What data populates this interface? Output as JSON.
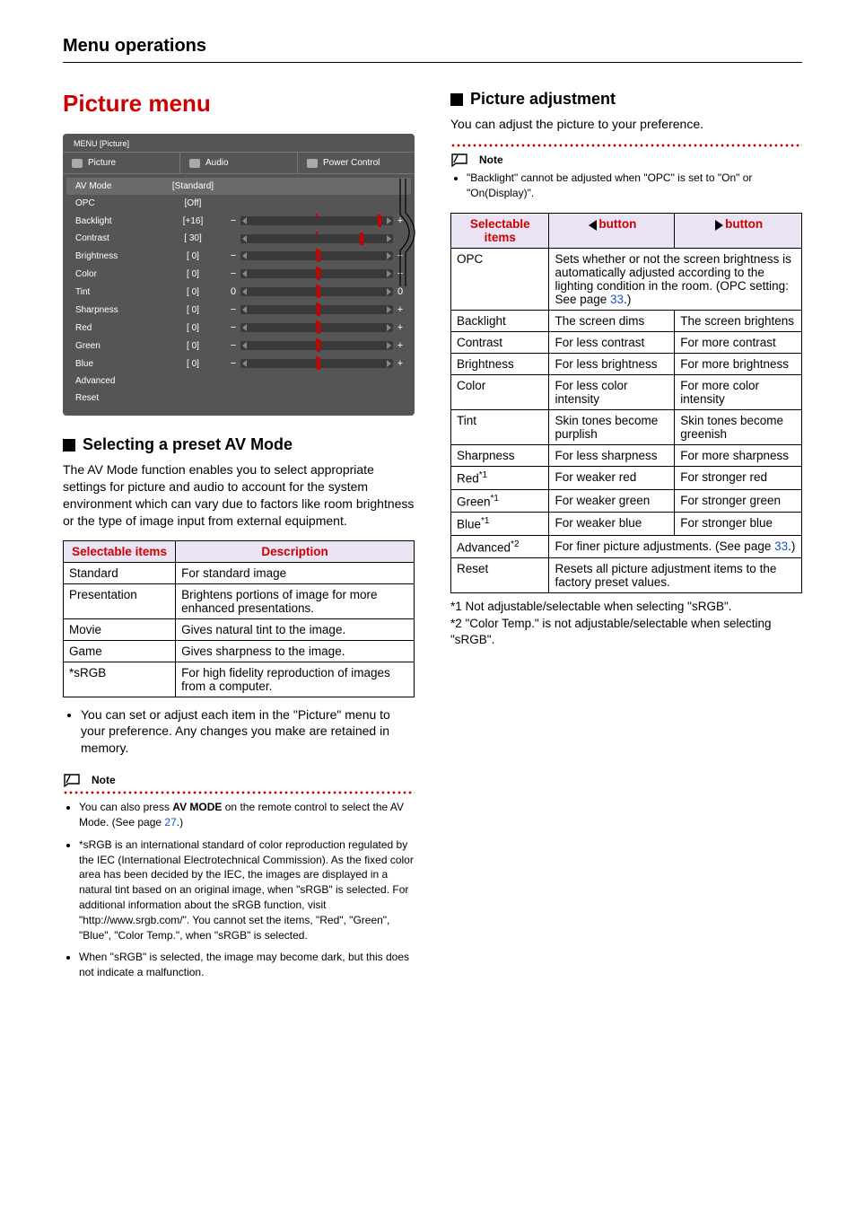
{
  "header": {
    "title": "Menu operations"
  },
  "left": {
    "h1": "Picture menu",
    "panel": {
      "title": "MENU [Picture]",
      "tabs": [
        "Picture",
        "Audio",
        "Power Control"
      ],
      "rows": [
        {
          "label": "AV Mode",
          "value": "[Standard]",
          "slider": false
        },
        {
          "label": "OPC",
          "value": "[Off]",
          "slider": false
        },
        {
          "label": "Backlight",
          "value": "[+16]",
          "slider": true,
          "thumb_pct": 90,
          "left_zero": false
        },
        {
          "label": "Contrast",
          "value": "[  30]",
          "slider": true,
          "thumb_pct": 78,
          "left_zero": false,
          "no_signs": true
        },
        {
          "label": "Brightness",
          "value": "[    0]",
          "slider": true,
          "thumb_pct": 50,
          "left_zero": false
        },
        {
          "label": "Color",
          "value": "[    0]",
          "slider": true,
          "thumb_pct": 50,
          "left_zero": false
        },
        {
          "label": "Tint",
          "value": "[    0]",
          "slider": true,
          "thumb_pct": 50,
          "left_zero": true
        },
        {
          "label": "Sharpness",
          "value": "[    0]",
          "slider": true,
          "thumb_pct": 50,
          "left_zero": false
        },
        {
          "label": "Red",
          "value": "[    0]",
          "slider": true,
          "thumb_pct": 50,
          "left_zero": false
        },
        {
          "label": "Green",
          "value": "[    0]",
          "slider": true,
          "thumb_pct": 50,
          "left_zero": false
        },
        {
          "label": "Blue",
          "value": "[    0]",
          "slider": true,
          "thumb_pct": 50,
          "left_zero": false
        },
        {
          "label": "Advanced",
          "value": "",
          "slider": false
        },
        {
          "label": "Reset",
          "value": "",
          "slider": false
        }
      ]
    },
    "avmode": {
      "heading": "Selecting a preset AV Mode",
      "desc": "The AV Mode function enables you to select appropriate settings for picture and audio to account for the system environment which can vary due to factors like room brightness or the type of image input from external equipment.",
      "table_head": [
        "Selectable items",
        "Description"
      ],
      "rows": [
        {
          "item": "Standard",
          "desc": "For standard image"
        },
        {
          "item": "Presentation",
          "desc": "Brightens portions of image for more enhanced presentations."
        },
        {
          "item": "Movie",
          "desc": "Gives natural tint to the image."
        },
        {
          "item": "Game",
          "desc": "Gives sharpness to the image."
        },
        {
          "item": "*sRGB",
          "desc": "For high fidelity reproduction of images from a computer."
        }
      ],
      "footer_bullet": "You can set or adjust each item in the \"Picture\" menu to your preference. Any changes you make are retained in memory."
    },
    "note": {
      "label": "Note",
      "items": [
        {
          "pre": "You can also press ",
          "bold": "AV MODE",
          "post": " on the remote control to select the AV Mode. (See page ",
          "link": "27",
          "tail": ".)"
        },
        {
          "text": "*sRGB is an international standard of color reproduction regulated by the IEC (International Electrotechnical Commission). As the fixed color area has been decided by the IEC, the images are displayed in a natural tint based on an original image, when \"sRGB\" is selected. For additional information about the sRGB function, visit \"http://www.srgb.com/\". You cannot set the items, \"Red\", \"Green\", \"Blue\", \"Color Temp.\", when \"sRGB\" is selected."
        },
        {
          "text": "When \"sRGB\" is selected, the image may become dark, but this does not indicate a malfunction."
        }
      ]
    }
  },
  "right": {
    "heading": "Picture adjustment",
    "desc": "You can adjust the picture to your preference.",
    "note": {
      "label": "Note",
      "text": "\"Backlight\" cannot be adjusted when \"OPC\" is set to \"On\" or \"On(Display)\"."
    },
    "table_head": {
      "items": "Selectable items",
      "left": "button",
      "right": "button"
    },
    "opc_cell": {
      "pre": "Sets whether or not the screen brightness is automatically adjusted according to the lighting condition in the room. (OPC setting: See page ",
      "link": "33",
      "tail": ".)"
    },
    "rows": [
      {
        "item": "OPC",
        "span": true
      },
      {
        "item": "Backlight",
        "l": "The screen dims",
        "r": "The screen brightens"
      },
      {
        "item": "Contrast",
        "l": "For less contrast",
        "r": "For more contrast"
      },
      {
        "item": "Brightness",
        "l": "For less brightness",
        "r": "For more brightness"
      },
      {
        "item": "Color",
        "l": "For less color intensity",
        "r": "For more color intensity"
      },
      {
        "item": "Tint",
        "l": "Skin tones become purplish",
        "r": "Skin tones become greenish"
      },
      {
        "item": "Sharpness",
        "l": "For less sharpness",
        "r": "For more sharpness"
      },
      {
        "item": "Red",
        "sup": "*1",
        "l": "For weaker red",
        "r": "For stronger red"
      },
      {
        "item": "Green",
        "sup": "*1",
        "l": "For weaker green",
        "r": "For stronger green"
      },
      {
        "item": "Blue",
        "sup": "*1",
        "l": "For weaker blue",
        "r": "For stronger blue"
      },
      {
        "item": "Advanced",
        "sup": "*2",
        "span": true,
        "span_pre": "For finer picture adjustments. (See page ",
        "span_link": "33",
        "span_tail": ".)"
      },
      {
        "item": "Reset",
        "span": true,
        "span_text": "Resets all picture adjustment items to the factory preset values."
      }
    ],
    "footnotes": [
      "*1 Not adjustable/selectable when selecting \"sRGB\".",
      "*2 \"Color Temp.\" is not adjustable/selectable when selecting \"sRGB\"."
    ]
  }
}
